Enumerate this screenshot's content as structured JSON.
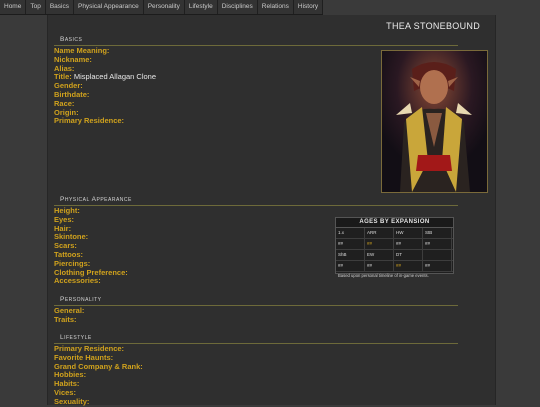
{
  "nav": [
    "Home",
    "Top",
    "Basics",
    "Physical Appearance",
    "Personality",
    "Lifestyle",
    "Disciplines",
    "Relations",
    "History"
  ],
  "character_name": "THEA STONEBOUND",
  "basics": {
    "title": "Basics",
    "fields": [
      {
        "label": "Name Meaning:",
        "value": ""
      },
      {
        "label": "Nickname:",
        "value": ""
      },
      {
        "label": "Alias:",
        "value": ""
      },
      {
        "label": "Title:",
        "value": "Misplaced Allagan Clone"
      },
      {
        "label": "Gender:",
        "value": ""
      },
      {
        "label": "Birthdate:",
        "value": ""
      },
      {
        "label": "Race:",
        "value": ""
      },
      {
        "label": "Origin:",
        "value": ""
      },
      {
        "label": "Primary Residence:",
        "value": ""
      }
    ]
  },
  "physical": {
    "title": "Physical Appearance",
    "fields": [
      {
        "label": "Height:",
        "value": ""
      },
      {
        "label": "Eyes:",
        "value": ""
      },
      {
        "label": "Hair:",
        "value": ""
      },
      {
        "label": "Skintone:",
        "value": ""
      },
      {
        "label": "Scars:",
        "value": ""
      },
      {
        "label": "Tattoos:",
        "value": ""
      },
      {
        "label": "Piercings:",
        "value": ""
      },
      {
        "label": "Clothing Preference:",
        "value": ""
      },
      {
        "label": "Accessories:",
        "value": ""
      }
    ]
  },
  "personality": {
    "title": "Personality",
    "fields": [
      {
        "label": "General:",
        "value": ""
      },
      {
        "label": "Traits:",
        "value": ""
      }
    ]
  },
  "lifestyle": {
    "title": "Lifestyle",
    "fields": [
      {
        "label": "Primary Residence:",
        "value": ""
      },
      {
        "label": "Favorite Haunts:",
        "value": ""
      },
      {
        "label": "Grand Company & Rank:",
        "value": ""
      },
      {
        "label": "Hobbies:",
        "value": ""
      },
      {
        "label": "Habits:",
        "value": ""
      },
      {
        "label": "Vices:",
        "value": ""
      },
      {
        "label": "Sexuality:",
        "value": ""
      }
    ]
  },
  "ages": {
    "title": "AGES BY EXPANSION",
    "row1": [
      "1.x",
      "ARR",
      "HW",
      "StB"
    ],
    "row2": [
      "##",
      "##",
      "##",
      "##"
    ],
    "row3": [
      "ShB",
      "EW",
      "DT",
      ""
    ],
    "row4": [
      "##",
      "##",
      "##",
      "##"
    ],
    "note": "Based upon personal timeline of in-game events."
  },
  "colors": {
    "label": "#d0a21d",
    "accent_line": "#6d6a3a",
    "background": "#3a3a3a"
  }
}
